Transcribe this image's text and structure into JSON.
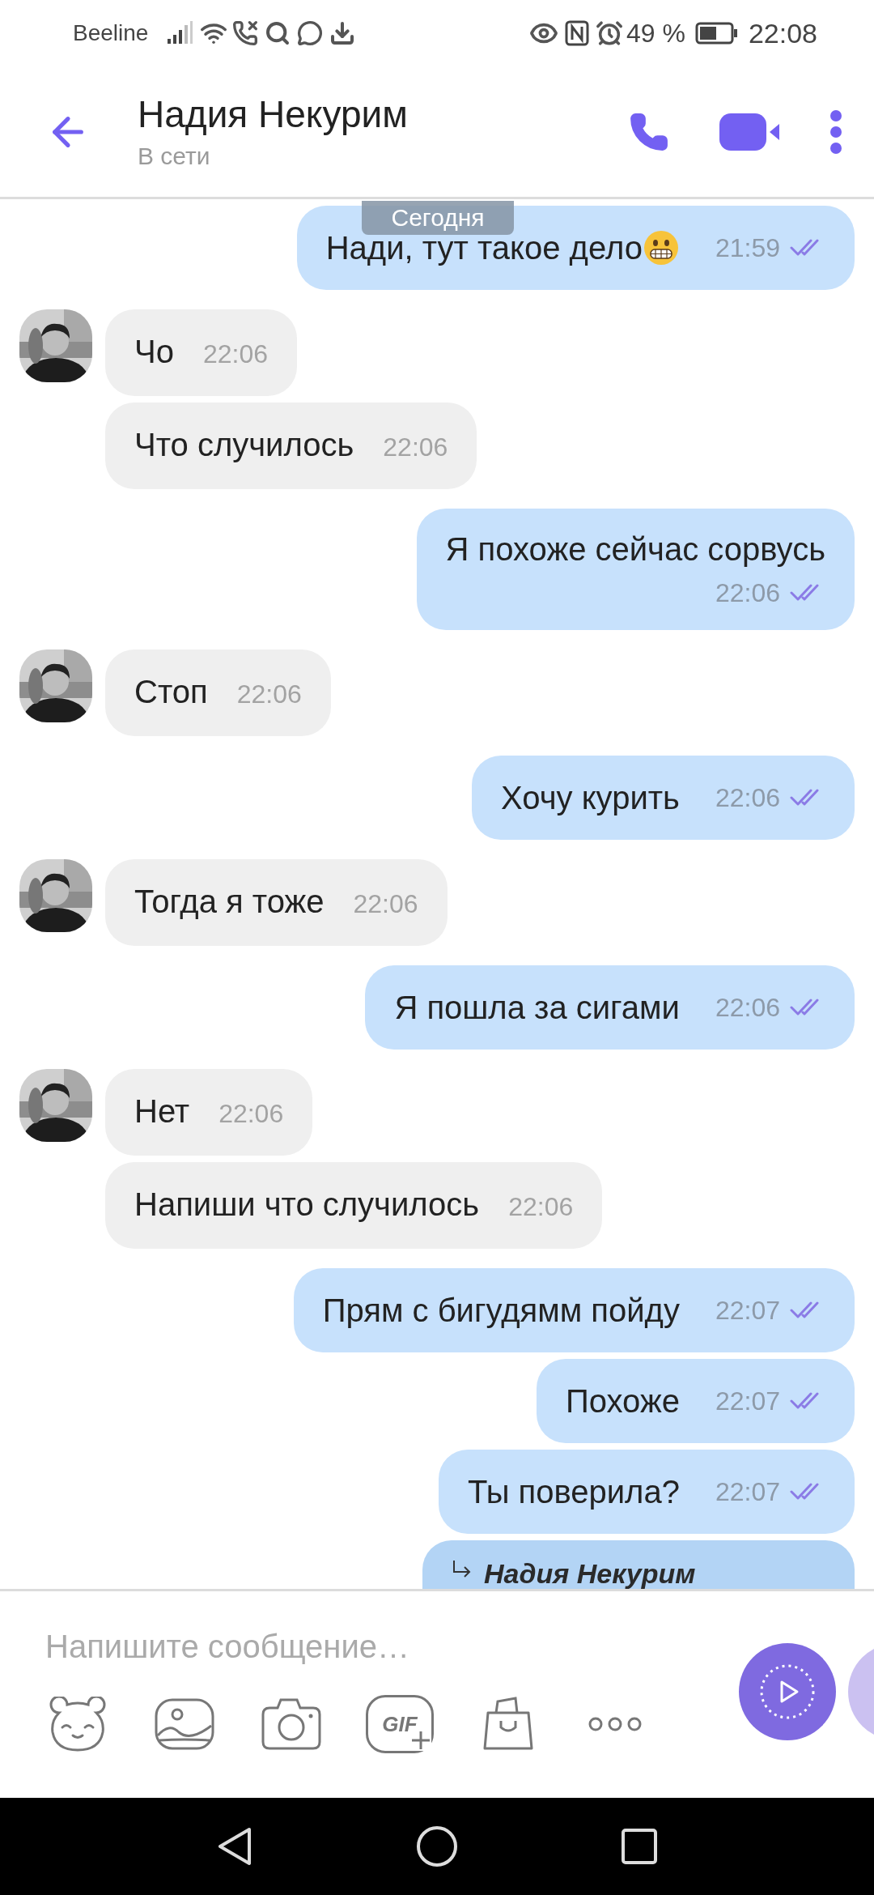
{
  "status_bar": {
    "carrier": "Beeline",
    "battery": "49 %",
    "time": "22:08"
  },
  "header": {
    "title": "Надия Некурим",
    "subtitle": "В сети"
  },
  "date_label": "Сегодня",
  "messages": [
    {
      "kind": "outgoing",
      "text": "Нади, тут такое дело",
      "emoji": true,
      "time": "21:59",
      "read": true,
      "wrapped": false
    },
    {
      "kind": "incoming",
      "text": "Чо",
      "time": "22:06",
      "avatar": true
    },
    {
      "kind": "incoming",
      "text": "Что случилось",
      "time": "22:06",
      "avatar": false
    },
    {
      "kind": "outgoing",
      "text": "Я похоже сейчас сорвусь",
      "time": "22:06",
      "read": true,
      "wrapped": true
    },
    {
      "kind": "incoming",
      "text": "Стоп",
      "time": "22:06",
      "avatar": true
    },
    {
      "kind": "outgoing",
      "text": "Хочу курить",
      "time": "22:06",
      "read": true,
      "wrapped": false
    },
    {
      "kind": "incoming",
      "text": "Тогда я тоже",
      "time": "22:06",
      "avatar": true
    },
    {
      "kind": "outgoing",
      "text": "Я пошла за сигами",
      "time": "22:06",
      "read": true,
      "wrapped": false
    },
    {
      "kind": "incoming",
      "text": "Нет",
      "time": "22:06",
      "avatar": true
    },
    {
      "kind": "incoming",
      "text": "Напиши что случилось",
      "time": "22:06",
      "avatar": false
    },
    {
      "kind": "outgoing",
      "text": "Прям с бигудямм пойду",
      "time": "22:07",
      "read": true,
      "wrapped": false
    },
    {
      "kind": "outgoing",
      "text": "Похоже",
      "time": "22:07",
      "read": true,
      "wrapped": false
    },
    {
      "kind": "outgoing",
      "text": "Ты поверила?",
      "time": "22:07",
      "read": true,
      "wrapped": false
    },
    {
      "kind": "reply",
      "quoted_name": "Надия Некурим"
    }
  ],
  "composer": {
    "placeholder": "Напишите сообщение…",
    "gif_label": "GIF"
  }
}
